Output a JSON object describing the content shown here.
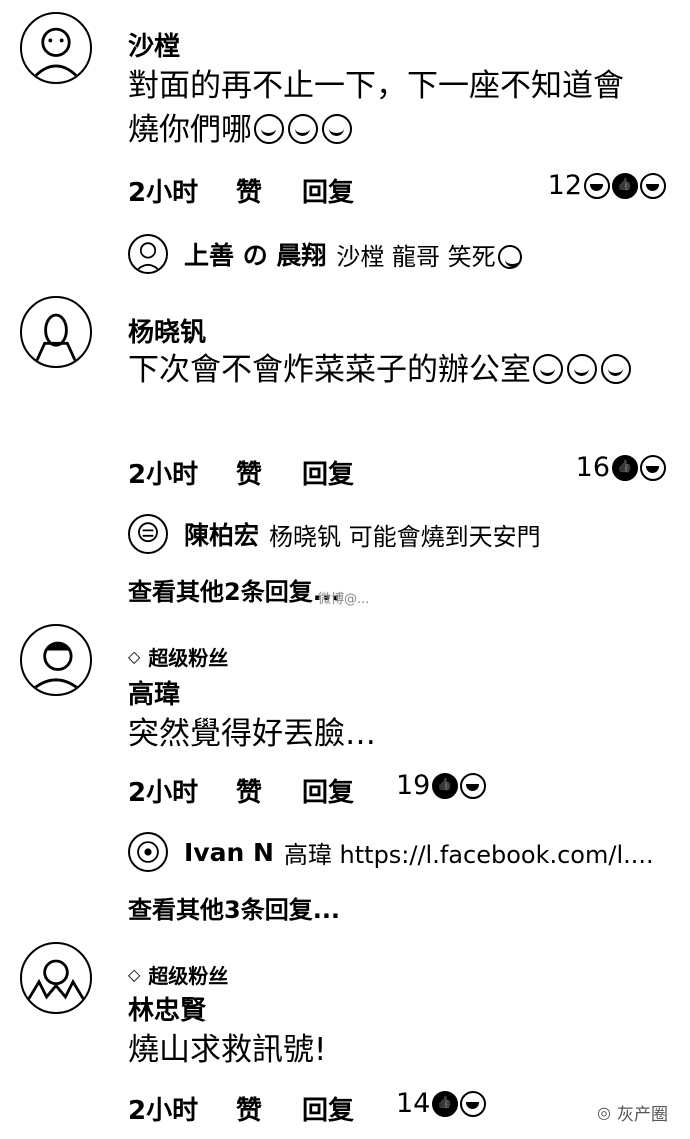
{
  "comments": [
    {
      "author": "沙樘",
      "text": "對面的再不止一下，下一座不知道會燒你們哪",
      "time": "2小时",
      "like_label": "赞",
      "reply_label": "回复",
      "reaction_count": "12",
      "reply": {
        "name": "上善 の 晨翔",
        "text": "沙樘 龍哥 笑死"
      }
    },
    {
      "author": "杨晓钒",
      "text": "下次會不會炸菜菜子的辦公室",
      "time": "2小时",
      "like_label": "赞",
      "reply_label": "回复",
      "reaction_count": "16",
      "reply": {
        "name": "陳柏宏",
        "text": "杨晓钒 可能會燒到天安門"
      },
      "more_replies": "查看其他2条回复..."
    },
    {
      "badge": "超级粉丝",
      "author": "高瑋",
      "text": "突然覺得好丟臉…",
      "time": "2小时",
      "like_label": "赞",
      "reply_label": "回复",
      "reaction_count": "19",
      "reply": {
        "name": "Ivan N",
        "text": "高瑋 https://l.facebook.com/l...."
      },
      "more_replies": "查看其他3条回复..."
    },
    {
      "badge": "超级粉丝",
      "author": "林忠賢",
      "text": "燒山求救訊號!",
      "time": "2小时",
      "like_label": "赞",
      "reply_label": "回复",
      "reaction_count": "14"
    }
  ],
  "watermark_mid": "微博@...",
  "watermark_br": "灰产圈",
  "icons": {
    "badge": "diamond-icon",
    "emoji": "laughing-emoji-icon",
    "like": "like-reaction-icon",
    "haha": "haha-reaction-icon"
  }
}
